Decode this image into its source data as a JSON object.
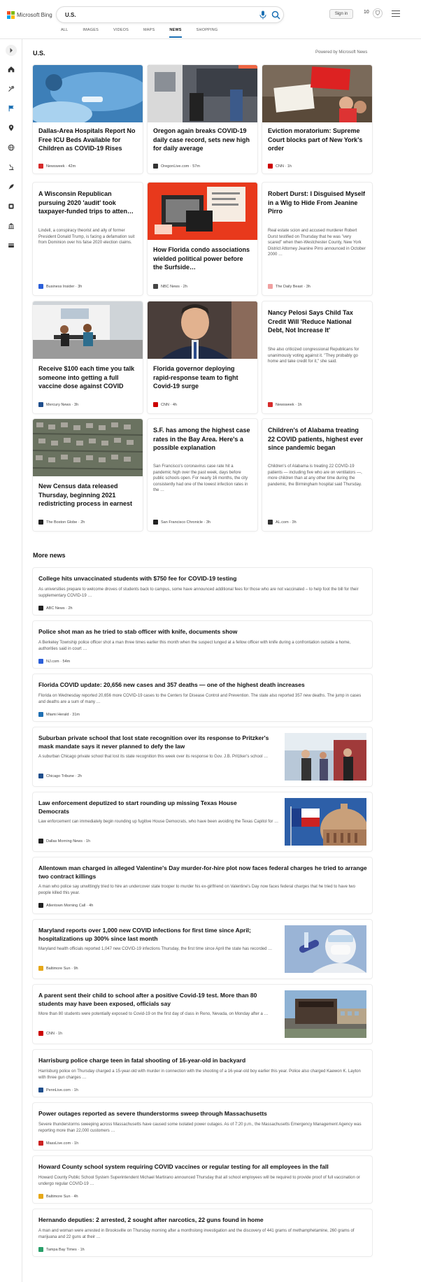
{
  "header": {
    "logo_text": "Microsoft Bing",
    "search_value": "U.S.",
    "signin_label": "Sign in",
    "points": "10",
    "tabs": [
      "ALL",
      "IMAGES",
      "VIDEOS",
      "MAPS",
      "NEWS",
      "SHOPPING"
    ],
    "active_tab": "NEWS"
  },
  "colors": {
    "accent": "#1a6fb3",
    "logo_red": "#f25022",
    "logo_green": "#7fba00",
    "logo_blue": "#00a4ef",
    "logo_yellow": "#ffb900"
  },
  "rail": {
    "icons": [
      "expand-icon",
      "home-icon",
      "tools-icon",
      "flag-icon",
      "location-icon",
      "globe-icon",
      "microscope-icon",
      "rocket-icon",
      "film-icon",
      "bank-icon",
      "card-icon"
    ]
  },
  "section": {
    "title": "U.S.",
    "powered_by": "Powered by Microsoft News"
  },
  "cards": [
    {
      "title": "Dallas-Area Hospitals Report No Free ICU Beds Available for Children as COVID-19 Rises",
      "snippet": "",
      "source": "Newsweek",
      "time": "42m",
      "fav_color": "#d62b2b"
    },
    {
      "title": "Oregon again breaks COVID-19 daily case record, sets new high for daily average",
      "snippet": "",
      "source": "OregonLive.com",
      "time": "57m",
      "fav_color": "#333333"
    },
    {
      "title": "Eviction moratorium: Supreme Court blocks part of New York's order",
      "snippet": "",
      "source": "CNN",
      "time": "1h",
      "fav_color": "#cc0000"
    },
    {
      "title": "A Wisconsin Republican pursuing 2020 'audit' took taxpayer-funded trips to atten…",
      "snippet": "Lindell, a conspiracy theorist and ally of former President Donald Trump, is facing a defamation suit from Dominion over his false 2020 election claims.",
      "source": "Business Insider",
      "time": "3h",
      "fav_color": "#2b5fd9"
    },
    {
      "title": "How Florida condo associations wielded political power before the Surfside…",
      "snippet": "",
      "source": "NBC News",
      "time": "2h",
      "fav_color": "#444444"
    },
    {
      "title": "Robert Durst: I Disguised Myself in a Wig to Hide From Jeanine Pirro",
      "snippet": "Real estate scion and accused murderer Robert Durst testified on Thursday that he was \"very scared\" when then-Westchester County, New York District Attorney Jeanine Pirro announced in October 2000 …",
      "source": "The Daily Beast",
      "time": "3h",
      "fav_color": "#f0a0a0"
    },
    {
      "title": "Receive $100 each time you talk someone into getting a full vaccine dose against COVID",
      "snippet": "",
      "source": "Mercury News",
      "time": "3h",
      "fav_color": "#1f4e8c"
    },
    {
      "title": "Florida governor deploying rapid-response team to fight Covid-19 surge",
      "snippet": "",
      "source": "CNN",
      "time": "4h",
      "fav_color": "#cc0000"
    },
    {
      "title": "Nancy Pelosi Says Child Tax Credit Will 'Reduce National Debt, Not Increase It'",
      "snippet": "She also criticized congressional Republicans for unanimously voting against it. \"They probably go home and take credit for it,\" she said.",
      "source": "Newsweek",
      "time": "1h",
      "fav_color": "#d62b2b"
    },
    {
      "title": "New Census data released Thursday, beginning 2021 redistricting process in earnest",
      "snippet": "",
      "source": "The Boston Globe",
      "time": "2h",
      "fav_color": "#222222"
    },
    {
      "title": "S.F. has among the highest case rates in the Bay Area. Here's a possible explanation",
      "snippet": "San Francisco's coronavirus case rate hit a pandemic high over the past week, days before public schools open. For nearly 16 months, the city consistently had one of the lowest infection rates in the …",
      "source": "San Francisco Chronicle",
      "time": "3h",
      "fav_color": "#222222"
    },
    {
      "title": "Children's of Alabama treating 22 COVID patients, highest ever since pandemic began",
      "snippet": "Children's of Alabama is treating 22 COVID-19 patients — including five who are on ventilators —, more children than at any other time during the pandemic, the Birmingham hospital said Thursday.",
      "source": "AL.com",
      "time": "3h",
      "fav_color": "#333333"
    }
  ],
  "more": {
    "title": "More news",
    "items": [
      {
        "title": "College hits unvaccinated students with $750 fee for COVID-19 testing",
        "snippet": "As universities prepare to welcome droves of students back to campus, some have announced additional fees for those who are not vaccinated – to help foot the bill for their supplementary COVID-19 …",
        "source": "ABC News",
        "time": "2h",
        "fav_color": "#222222"
      },
      {
        "title": "Police shot man as he tried to stab officer with knife, documents show",
        "snippet": "A Berkeley Township police officer shot a man three times earlier this month when the suspect lunged at a fellow officer with knife during a confrontation outside a home, authorities said in court …",
        "source": "NJ.com",
        "time": "54m",
        "fav_color": "#2b5fd9"
      },
      {
        "title": "Florida COVID update: 20,656 new cases and 357 deaths — one of the highest death increases",
        "snippet": "Florida on Wednesday reported 20,656 more COVID-19 cases to the Centers for Disease Control and Prevention. The state also reported 357 new deaths. The jump in cases and deaths are a sum of many …",
        "source": "Miami Herald",
        "time": "31m",
        "fav_color": "#1f6fb3"
      },
      {
        "title": "Suburban private school that lost state recognition over its response to Pritzker's mask mandate says it never planned to defy the law",
        "snippet": "A suburban Chicago private school that lost its state recognition this week over its response to Gov. J.B. Pritzker's school …",
        "source": "Chicago Tribune",
        "time": "2h",
        "fav_color": "#1f4e8c"
      },
      {
        "title": "Law enforcement deputized to start rounding up missing Texas House Democrats",
        "snippet": "Law enforcement can immediately begin rounding up fugitive House Democrats, who have been avoiding the Texas Capitol for …",
        "source": "Dallas Morning News",
        "time": "1h",
        "fav_color": "#222222"
      },
      {
        "title": "Allentown man charged in alleged Valentine's Day murder-for-hire plot now faces federal charges he tried to arrange two contract killings",
        "snippet": "A man who police say unwittingly tried to hire an undercover state trooper to murder his ex-girlfriend on Valentine's Day now faces federal charges that he tried to have two people killed this year.",
        "source": "Allentown Morning Call",
        "time": "4h",
        "fav_color": "#222222"
      },
      {
        "title": "Maryland reports over 1,000 new COVID infections for first time since April; hospitalizations up 300% since last month",
        "snippet": "Maryland health officials reported 1,047 new COVID-19 infections Thursday, the first time since April the state has recorded …",
        "source": "Baltimore Sun",
        "time": "9h",
        "fav_color": "#e6a817"
      },
      {
        "title": "A parent sent their child to school after a positive Covid-19 test. More than 80 students may have been exposed, officials say",
        "snippet": "More than 80 students were potentially exposed to Covid-19 on the first day of class in Reno, Nevada, on Monday after a …",
        "source": "CNN",
        "time": "1h",
        "fav_color": "#cc0000"
      },
      {
        "title": "Harrisburg police charge teen in fatal shooting of 16-year-old in backyard",
        "snippet": "Harrisburg police on Thursday charged a 15-year-old with murder in connection with the shooting of a 16-year-old boy earlier this year. Police also charged Kaewon K. Layton with three gun charges …",
        "source": "PennLive.com",
        "time": "1h",
        "fav_color": "#1f4e8c"
      },
      {
        "title": "Power outages reported as severe thunderstorms sweep through Massachusetts",
        "snippet": "Severe thunderstorms sweeping across Massachusetts have caused some isolated power outages. As of 7:20 p.m., the Massachusetts Emergency Management Agency was reporting more than 22,000 customers …",
        "source": "MassLive.com",
        "time": "1h",
        "fav_color": "#cc2222"
      },
      {
        "title": "Howard County school system requiring COVID vaccines or regular testing for all employees in the fall",
        "snippet": "Howard County Public School System Superintendent Michael Martirano announced Thursday that all school employees will be required to provide proof of full vaccination or undergo regular COVID-19 …",
        "source": "Baltimore Sun",
        "time": "4h",
        "fav_color": "#e6a817"
      },
      {
        "title": "Hernando deputies: 2 arrested, 2 sought after narcotics, 22 guns found in home",
        "snippet": "A man and woman were arrested in Brooksville on Thursday morning after a monthslong investigation and the discovery of 441 grams of methamphetamine, 260 grams of marijuana and 22 guns at their …",
        "source": "Tampa Bay Times",
        "time": "1h",
        "fav_color": "#2aa06a"
      }
    ]
  }
}
